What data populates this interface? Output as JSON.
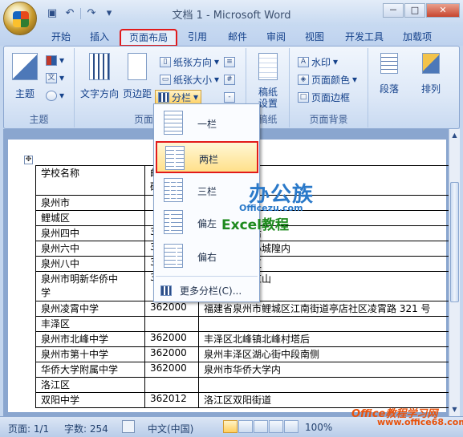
{
  "window": {
    "title": "文档 1 - Microsoft Word",
    "controls": [
      "－",
      "□",
      "✕"
    ]
  },
  "tabs": [
    "开始",
    "插入",
    "页面布局",
    "引用",
    "邮件",
    "审阅",
    "视图",
    "开发工具",
    "加载项"
  ],
  "active_tab": "页面布局",
  "ribbon": {
    "theme_group": {
      "label": "主题",
      "theme_button": "主题"
    },
    "page_setup_group": {
      "label_visible": "页面",
      "text_direction": "文字方向",
      "margins": "页边距",
      "paper_direction": "纸张方向",
      "paper_size": "纸张大小",
      "columns": "分栏"
    },
    "manuscript_group": {
      "label": "稿纸",
      "button": "稿纸\n设置"
    },
    "page_background_group": {
      "label": "页面背景",
      "watermark": "水印",
      "page_color": "页面颜色",
      "page_border": "页面边框"
    },
    "paragraph": "段落",
    "arrange": "排列"
  },
  "columns_menu": {
    "items": [
      "一栏",
      "两栏",
      "三栏",
      "偏左",
      "偏右"
    ],
    "selected": "两栏",
    "more": "更多分栏(C)..."
  },
  "table": {
    "rows": [
      [
        "学校名称",
        "邮\n码",
        ""
      ],
      [
        "泉州市",
        "",
        ""
      ],
      [
        "鲤城区",
        "",
        ""
      ],
      [
        "泉州四中",
        "3",
        "新华路大寺后"
      ],
      [
        "泉州六中",
        "3",
        "区镇抚司巷小城隍内"
      ],
      [
        "泉州八中",
        "3",
        "金山新村南区"
      ],
      [
        "泉州市明新华侨中\n学",
        "3",
        "区江南树兜红山"
      ],
      [
        "泉州凌霄中学",
        "362000",
        "福建省泉州市鲤城区江南街道亭店社区凌霄路 321 号"
      ],
      [
        "丰泽区",
        "",
        ""
      ],
      [
        "泉州市北峰中学",
        "362000",
        "丰泽区北峰镇北峰村塔后"
      ],
      [
        "泉州市第十中学",
        "362000",
        "泉州丰泽区湖心街中段南侧"
      ],
      [
        "华侨大学附属中学",
        "362000",
        "泉州市华侨大学内"
      ],
      [
        "洛江区",
        "",
        ""
      ],
      [
        "双阳中学",
        "362012",
        "洛江区双阳街道"
      ]
    ]
  },
  "watermarks": {
    "logo": "办公族",
    "site": "Officezu.com",
    "excel": "Excel教程",
    "footer": "Office教程学习网",
    "footer_url": "www.office68.com"
  },
  "status": {
    "page": "页面: 1/1",
    "words": "字数: 254",
    "lang": "中文(中国)",
    "zoom": "100%"
  }
}
